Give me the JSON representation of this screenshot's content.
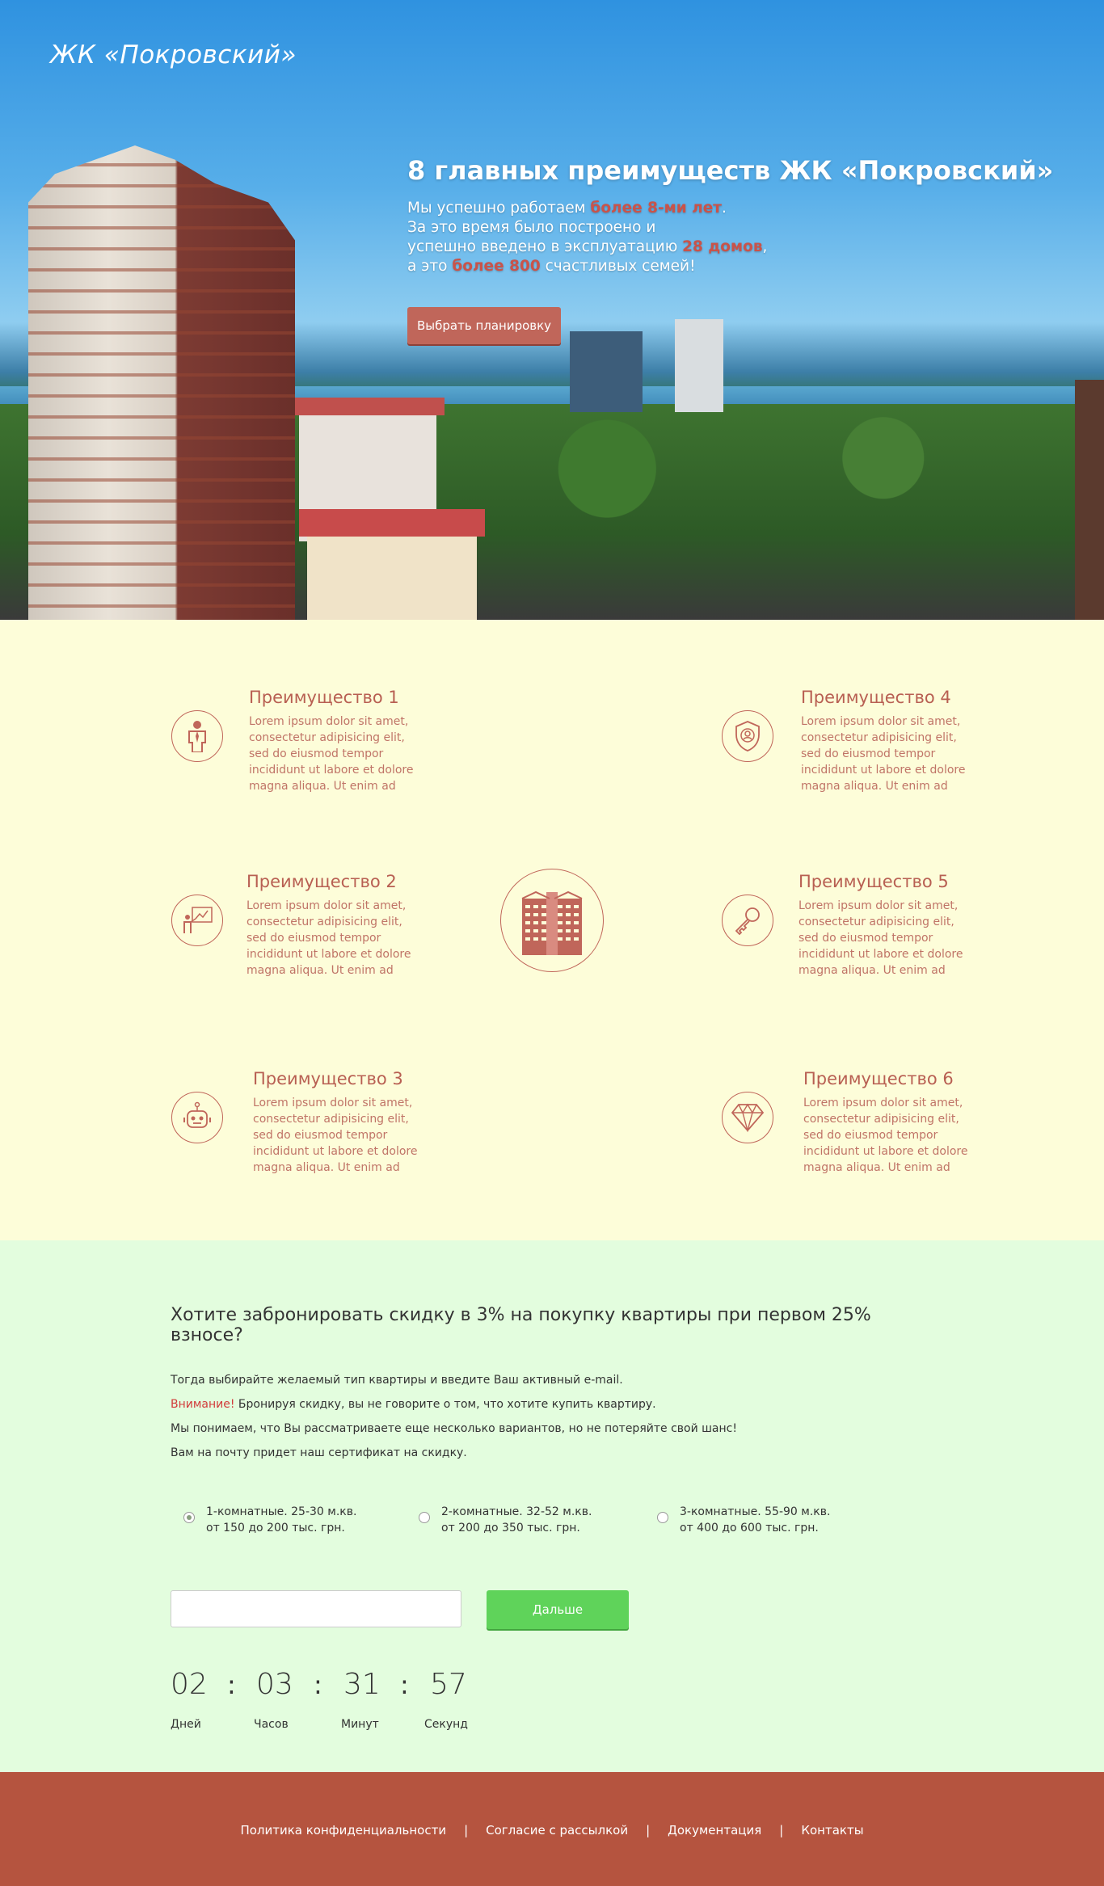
{
  "hero": {
    "logo": "ЖК «Покровский»",
    "title": "8 главных преимуществ ЖК «Покровский»",
    "line1_a": "Мы успешно работаем ",
    "line1_b": "более 8-ми лет",
    "line1_c": ".",
    "line2": "За это время было построено и",
    "line3_a": "успешно введено в эксплуатацию ",
    "line3_b": "28 домов",
    "line3_c": ",",
    "line4_a": "а это ",
    "line4_b": "более 800",
    "line4_c": " счастливых семей!",
    "button": "Выбрать планировку"
  },
  "benefits": [
    {
      "title": "Преимущество 1",
      "text": "Lorem ipsum dolor sit amet, consectetur adipisicing elit, sed do eiusmod tempor incididunt ut labore et dolore magna aliqua. Ut enim ad",
      "icon": "businessman-icon"
    },
    {
      "title": "Преимущество 2",
      "text": "Lorem ipsum dolor sit amet, consectetur adipisicing elit, sed do eiusmod tempor incididunt ut labore et dolore magna aliqua. Ut enim ad",
      "icon": "presentation-icon"
    },
    {
      "title": "Преимущество 3",
      "text": "Lorem ipsum dolor sit amet, consectetur adipisicing elit, sed do eiusmod tempor incididunt ut labore et dolore magna aliqua. Ut enim ad",
      "icon": "robot-icon"
    },
    {
      "title": "Преимущество 4",
      "text": "Lorem ipsum dolor sit amet, consectetur adipisicing elit, sed do eiusmod tempor incididunt ut labore et dolore magna aliqua. Ut enim ad",
      "icon": "user-shield-icon"
    },
    {
      "title": "Преимущество 5",
      "text": "Lorem ipsum dolor sit amet, consectetur adipisicing elit, sed do eiusmod tempor incididunt ut labore et dolore magna aliqua. Ut enim ad",
      "icon": "key-icon"
    },
    {
      "title": "Преимущество 6",
      "text": "Lorem ipsum dolor sit amet, consectetur adipisicing elit, sed do eiusmod tempor incididunt ut labore et dolore magna aliqua. Ut enim ad",
      "icon": "diamond-icon"
    }
  ],
  "center_icon": "buildings-icon",
  "form": {
    "title": "Хотите забронировать скидку в 3% на покупку квартиры при первом 25% взносе?",
    "p1": "Тогда выбирайте желаемый тип квартиры и введите Ваш активный e-mail.",
    "warn": "Внимание!",
    "p2": " Бронируя скидку, вы не говорите о том, что хотите купить квартиру.",
    "p3": "Мы понимаем, что Вы рассматриваете еще несколько вариантов, но не потеряйте свой шанс!",
    "p4": "Вам на почту придет наш сертификат на скидку.",
    "options": [
      {
        "line1": "1-комнатные. 25-30 м.кв.",
        "line2": "от 150 до 200 тыс. грн.",
        "checked": true
      },
      {
        "line1": "2-комнатные. 32-52 м.кв.",
        "line2": "от 200 до 350 тыс. грн.",
        "checked": false
      },
      {
        "line1": "3-комнатные. 55-90 м.кв.",
        "line2": "от 400 до 600 тыс. грн.",
        "checked": false
      }
    ],
    "email_value": "",
    "button": "Дальше"
  },
  "timer": {
    "days": "02",
    "hours": "03",
    "minutes": "31",
    "seconds": "57",
    "sep": ":",
    "days_label": "Дней",
    "hours_label": "Часов",
    "minutes_label": "Минут",
    "seconds_label": "Секунд"
  },
  "footer": {
    "links": [
      "Политика конфиденциальности",
      "Согласие с рассылкой",
      "Документация",
      "Контакты"
    ],
    "sep": "|"
  },
  "colors": {
    "accent": "#c0665a",
    "benefits_bg": "#fdfdd9",
    "form_bg": "#e3fdde",
    "footer_bg": "#b5543f",
    "next_button": "#5fd35a",
    "warning": "#d23b3b"
  }
}
